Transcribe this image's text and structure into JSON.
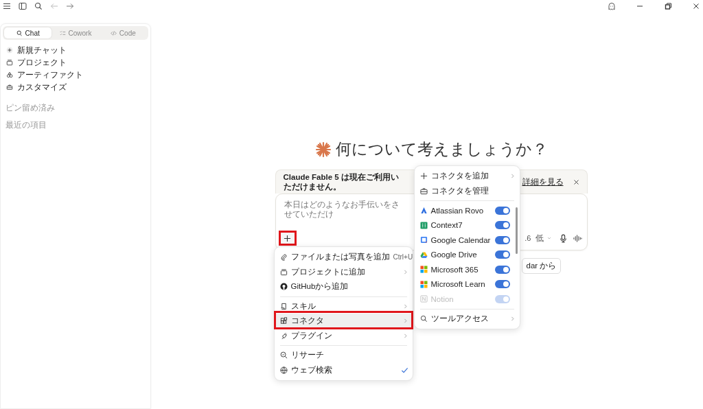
{
  "sidebar": {
    "tabs": [
      {
        "label": "Chat",
        "selected": true
      },
      {
        "label": "Cowork",
        "selected": false
      },
      {
        "label": "Code",
        "selected": false
      }
    ],
    "items": [
      {
        "label": "新規チャット"
      },
      {
        "label": "プロジェクト"
      },
      {
        "label": "アーティファクト"
      },
      {
        "label": "カスタマイズ"
      }
    ],
    "sections": [
      "ピン留め済み",
      "最近の項目"
    ]
  },
  "heading": "何について考えましょうか？",
  "banner": {
    "text": "Claude Fable 5 は現在ご利用いただけません。",
    "link": "詳細を見る"
  },
  "composer": {
    "placeholder": "本日はどのようなお手伝いをさせていただけ",
    "model": ".6",
    "effort": "低"
  },
  "chip": "dar から",
  "plus_menu": [
    {
      "label": "ファイルまたは写真を追加",
      "shortcut": "Ctrl+U",
      "submenu": false,
      "checked": false,
      "selected": false,
      "divider": false
    },
    {
      "label": "プロジェクトに追加",
      "submenu": true,
      "checked": false,
      "selected": false,
      "divider": false
    },
    {
      "label": "GitHubから追加",
      "submenu": false,
      "checked": false,
      "selected": false,
      "divider": false
    },
    {
      "label": "スキル",
      "submenu": true,
      "checked": false,
      "selected": false,
      "divider": true
    },
    {
      "label": "コネクタ",
      "submenu": true,
      "checked": false,
      "selected": true,
      "divider": false
    },
    {
      "label": "プラグイン",
      "submenu": true,
      "checked": false,
      "selected": false,
      "divider": false
    },
    {
      "label": "リサーチ",
      "submenu": false,
      "checked": false,
      "selected": false,
      "divider": true
    },
    {
      "label": "ウェブ検索",
      "submenu": false,
      "checked": true,
      "selected": false,
      "divider": false
    }
  ],
  "connector_menu": {
    "actions": [
      {
        "label": "コネクタを追加",
        "submenu": true
      },
      {
        "label": "コネクタを管理",
        "submenu": false
      }
    ],
    "connectors": [
      {
        "name": "Atlassian Rovo",
        "on": true,
        "faded": false
      },
      {
        "name": "Context7",
        "on": true,
        "faded": false
      },
      {
        "name": "Google Calendar",
        "on": true,
        "faded": false
      },
      {
        "name": "Google Drive",
        "on": true,
        "faded": false
      },
      {
        "name": "Microsoft 365",
        "on": true,
        "faded": false
      },
      {
        "name": "Microsoft Learn",
        "on": true,
        "faded": false
      },
      {
        "name": "Notion",
        "on": true,
        "faded": true
      }
    ],
    "footer": {
      "label": "ツールアクセス"
    }
  }
}
